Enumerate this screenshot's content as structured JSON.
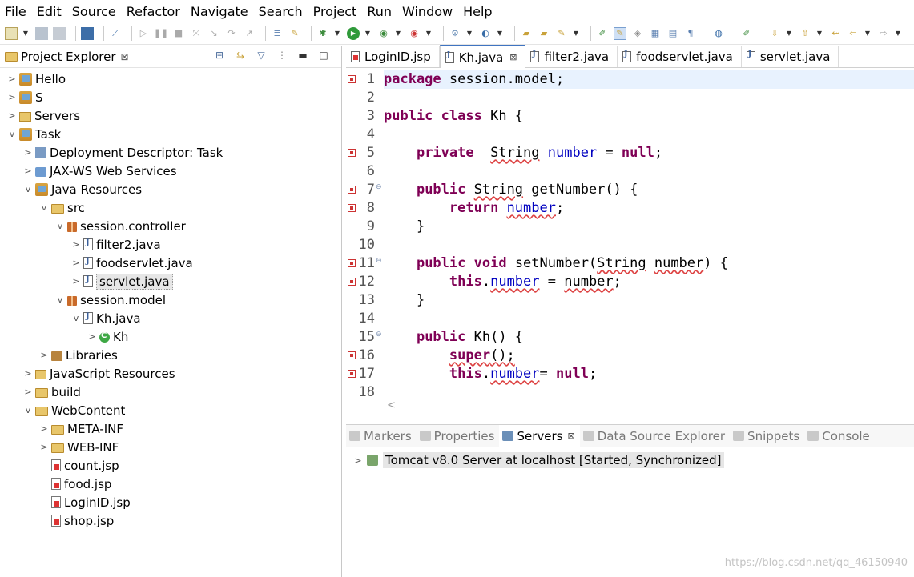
{
  "menu": [
    "File",
    "Edit",
    "Source",
    "Refactor",
    "Navigate",
    "Search",
    "Project",
    "Run",
    "Window",
    "Help"
  ],
  "explorer": {
    "title": "Project Explorer",
    "close_glyph": "⊠"
  },
  "tree": [
    {
      "label": "Hello",
      "twisty": ">",
      "icon": "project-icon"
    },
    {
      "label": "S",
      "twisty": ">",
      "icon": "project-icon"
    },
    {
      "label": "Servers",
      "twisty": ">",
      "icon": "servers-folder-icon"
    },
    {
      "label": "Task",
      "twisty": "v",
      "icon": "project-icon"
    },
    {
      "label": "Deployment Descriptor: Task",
      "twisty": ">",
      "icon": "deployment-descriptor-icon"
    },
    {
      "label": "JAX-WS Web Services",
      "twisty": ">",
      "icon": "web-services-icon"
    },
    {
      "label": "Java Resources",
      "twisty": "v",
      "icon": "java-resources-icon"
    },
    {
      "label": "src",
      "twisty": "v",
      "icon": "source-folder-icon"
    },
    {
      "label": "session.controller",
      "twisty": "v",
      "icon": "package-icon"
    },
    {
      "label": "filter2.java",
      "twisty": ">",
      "icon": "java-file-icon"
    },
    {
      "label": "foodservlet.java",
      "twisty": ">",
      "icon": "java-file-icon"
    },
    {
      "label": "servlet.java",
      "twisty": ">",
      "icon": "java-file-icon"
    },
    {
      "label": "session.model",
      "twisty": "v",
      "icon": "package-icon"
    },
    {
      "label": "Kh.java",
      "twisty": "v",
      "icon": "java-file-icon"
    },
    {
      "label": "Kh",
      "twisty": ">",
      "icon": "class-icon"
    },
    {
      "label": "Libraries",
      "twisty": ">",
      "icon": "libraries-icon"
    },
    {
      "label": "JavaScript Resources",
      "twisty": ">",
      "icon": "javascript-resources-icon"
    },
    {
      "label": "build",
      "twisty": ">",
      "icon": "folder-icon"
    },
    {
      "label": "WebContent",
      "twisty": "v",
      "icon": "folder-icon"
    },
    {
      "label": "META-INF",
      "twisty": ">",
      "icon": "folder-icon"
    },
    {
      "label": "WEB-INF",
      "twisty": ">",
      "icon": "folder-icon"
    },
    {
      "label": "count.jsp",
      "twisty": "",
      "icon": "jsp-file-icon"
    },
    {
      "label": "food.jsp",
      "twisty": "",
      "icon": "jsp-file-icon"
    },
    {
      "label": "LoginID.jsp",
      "twisty": "",
      "icon": "jsp-file-icon"
    },
    {
      "label": "shop.jsp",
      "twisty": "",
      "icon": "jsp-file-icon"
    }
  ],
  "editor_tabs": [
    {
      "label": "LoginID.jsp",
      "kind": "jsp"
    },
    {
      "label": "Kh.java",
      "kind": "java",
      "active": true
    },
    {
      "label": "filter2.java",
      "kind": "java"
    },
    {
      "label": "foodservlet.java",
      "kind": "java"
    },
    {
      "label": "servlet.java",
      "kind": "java"
    }
  ],
  "editor": {
    "lines": [
      "package session.model;",
      "",
      "public class Kh {",
      "",
      "    private  String number = null;",
      "",
      "    public String getNumber() {",
      "        return number;",
      "    }",
      "",
      "    public void setNumber(String number) {",
      "        this.number = number;",
      "    }",
      "",
      "    public Kh() {",
      "        super();",
      "        this.number= null;",
      ""
    ],
    "error_lines": [
      1,
      5,
      7,
      8,
      11,
      12,
      16,
      17
    ],
    "fold_lines": [
      7,
      11,
      15
    ]
  },
  "bottom": {
    "tabs": [
      {
        "label": "Markers"
      },
      {
        "label": "Properties"
      },
      {
        "label": "Servers",
        "active": true
      },
      {
        "label": "Data Source Explorer"
      },
      {
        "label": "Snippets"
      },
      {
        "label": "Console"
      }
    ],
    "server_entry": "Tomcat v8.0 Server at localhost  [Started, Synchronized]"
  },
  "watermark": "https://blog.csdn.net/qq_46150940"
}
